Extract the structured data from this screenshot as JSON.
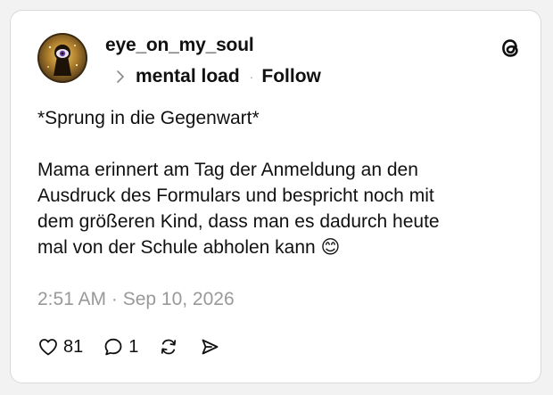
{
  "post": {
    "username": "eye_on_my_soul",
    "topic": "mental load",
    "follow_label": "Follow",
    "text": "*Sprung in die Gegenwart*\n\nMama erinnert am Tag der Anmeldung an den\nAusdruck des Formulars und bespricht noch mit\ndem größeren Kind, dass man es dadurch heute\nmal von der Schule abholen kann 😊",
    "timestamp": "2:51 AM · Sep 10, 2026"
  },
  "actions": {
    "likes": "81",
    "replies": "1"
  },
  "icons": {
    "avatar": "keyhole-eye-avatar",
    "topic_chevron": "chevron-right-icon",
    "brand": "threads-logo-icon",
    "like": "heart-icon",
    "reply": "speech-bubble-icon",
    "repost": "repost-icon",
    "share": "send-icon"
  },
  "colors": {
    "text": "#101010",
    "muted": "#999999",
    "border": "#d9d9d9",
    "background": "#ffffff"
  }
}
